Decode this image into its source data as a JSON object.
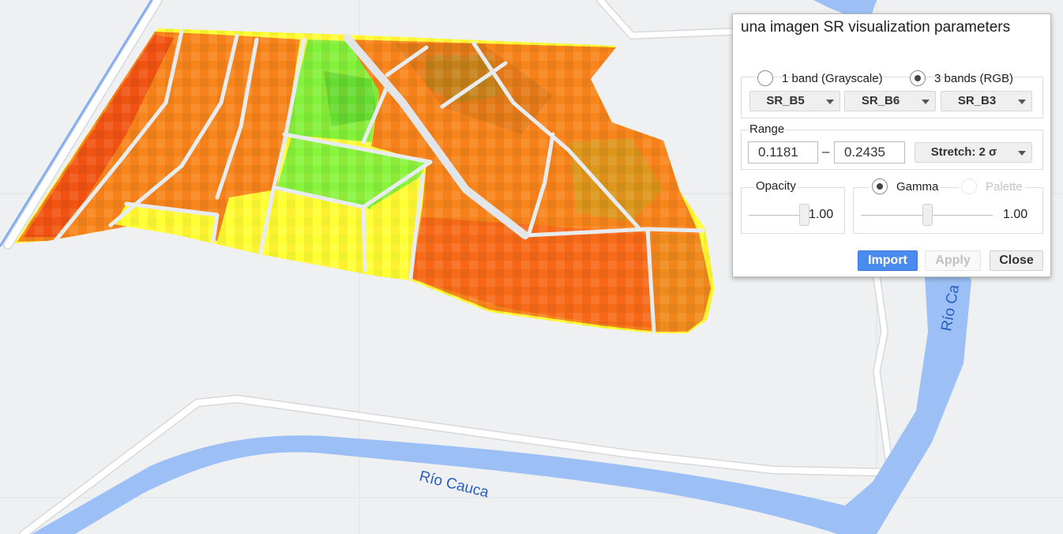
{
  "map": {
    "river_label_bottom": "Río Cauca",
    "river_label_right": "Río Ca",
    "colors": {
      "background": "#eef0f1",
      "river": "#9cc0f5",
      "road": "#ffffff",
      "field_orange": "#f7851c",
      "field_red": "#f04a12",
      "field_yellow": "#ffff33",
      "field_green": "#82f23a"
    }
  },
  "panel": {
    "title": "una imagen SR visualization parameters",
    "bands": {
      "option_1": "1 band (Grayscale)",
      "option_3": "3 bands (RGB)",
      "selected": "3 bands (RGB)",
      "red": "SR_B5",
      "green": "SR_B6",
      "blue": "SR_B3"
    },
    "range": {
      "legend": "Range",
      "min": "0.1181",
      "max": "0.2435",
      "separator": "–",
      "stretch": "Stretch: 2 σ"
    },
    "opacity": {
      "legend": "Opacity",
      "value": "1.00",
      "fraction": 1.0
    },
    "gamma": {
      "label": "Gamma",
      "palette_label": "Palette",
      "value": "1.00",
      "fraction": 0.5
    },
    "buttons": {
      "import": "Import",
      "apply": "Apply",
      "close": "Close"
    },
    "accent": "#4a8bef"
  }
}
